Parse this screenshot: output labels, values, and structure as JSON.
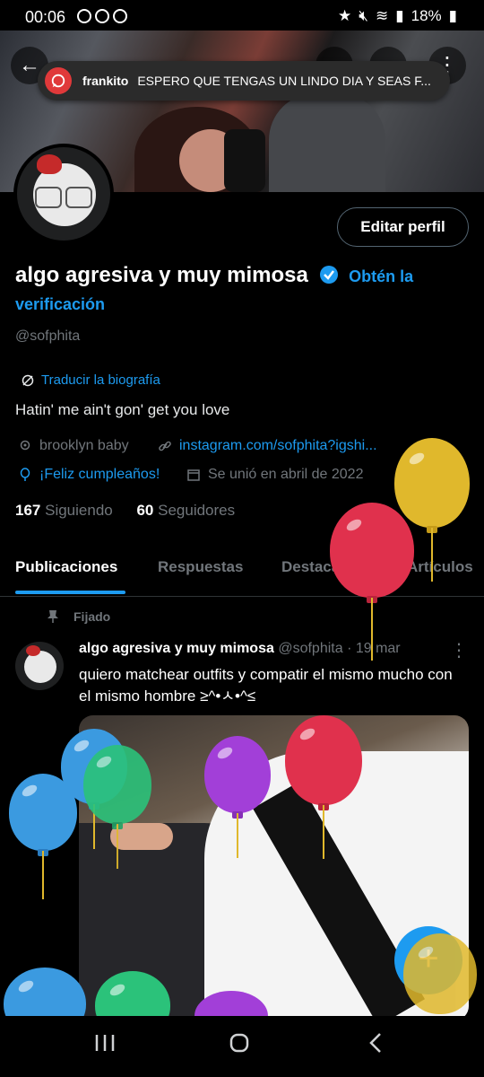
{
  "status_bar": {
    "time": "00:06",
    "battery": "18%"
  },
  "notification": {
    "sender": "frankito",
    "message": "ESPERO QUE TENGAS UN LINDO DIA Y SEAS F..."
  },
  "profile": {
    "edit_button": "Editar perfil",
    "display_name": "algo agresiva y muy mimosa",
    "verify_link": "Obtén la verificación",
    "handle": "@sofphita",
    "translate_bio": "Traducir la biografía",
    "bio": "Hatin' me ain't gon' get you love",
    "location": "brooklyn baby",
    "website": "instagram.com/sofphita?igshi...",
    "birthday": "¡Feliz cumpleaños!",
    "joined": "Se unió en abril de 2022",
    "following_count": "167",
    "following_label": "Siguiendo",
    "followers_count": "60",
    "followers_label": "Seguidores"
  },
  "tabs": [
    {
      "label": "Publicaciones",
      "active": true
    },
    {
      "label": "Respuestas",
      "active": false
    },
    {
      "label": "Destacados",
      "active": false
    },
    {
      "label": "Artículos",
      "active": false
    }
  ],
  "pinned_post": {
    "pinned_label": "Fijado",
    "author": "algo agresiva y muy mimosa",
    "handle": "@sofphita",
    "date": "· 19 mar",
    "text": "quiero matchear outfits y compatir el mismo mucho con el mismo hombre ≥^•ㅅ•^≤"
  },
  "colors": {
    "accent": "#1d9bf0",
    "background": "#000000",
    "secondary_text": "#71767b"
  },
  "icons": [
    "back-arrow-icon",
    "whatsapp-icon",
    "verified-badge-icon",
    "translate-icon",
    "location-icon",
    "link-icon",
    "balloon-icon",
    "calendar-icon",
    "pin-icon",
    "more-icon",
    "compose-plus-icon"
  ]
}
